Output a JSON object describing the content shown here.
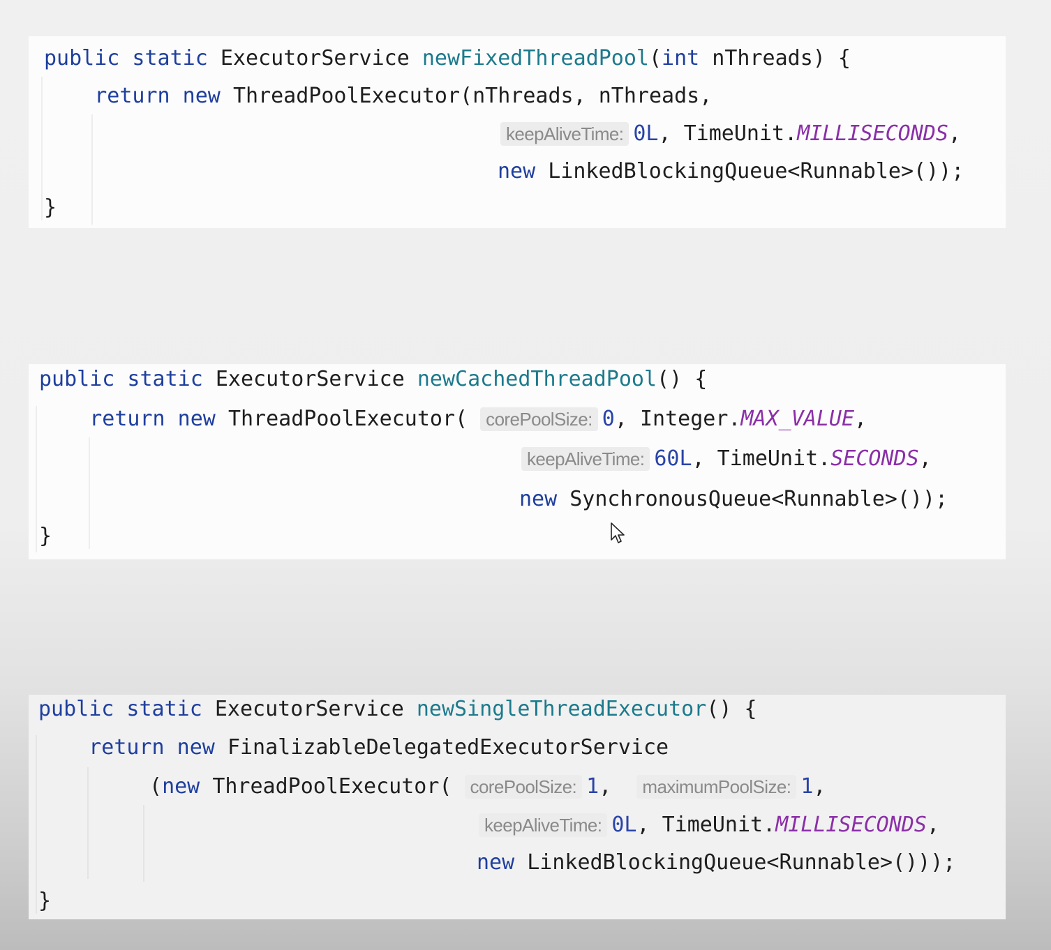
{
  "blocks": [
    {
      "lines": [
        [
          {
            "t": "public static ",
            "c": "kw"
          },
          {
            "t": "ExecutorService ",
            "c": "plain"
          },
          {
            "t": "newFixedThreadPool",
            "c": "fn"
          },
          {
            "t": "(",
            "c": "plain"
          },
          {
            "t": "int",
            "c": "kw"
          },
          {
            "t": " nThreads) {",
            "c": "plain"
          }
        ],
        [
          {
            "t": "    return new ",
            "c": "kw"
          },
          {
            "t": "ThreadPoolExecutor(nThreads, nThreads,",
            "c": "plain"
          }
        ],
        [
          {
            "t": "keepAliveTime:",
            "c": "hint"
          },
          {
            "t": "0L",
            "c": "num"
          },
          {
            "t": ", TimeUnit.",
            "c": "plain"
          },
          {
            "t": "MILLISECONDS",
            "c": "const"
          },
          {
            "t": ",",
            "c": "plain"
          }
        ],
        [
          {
            "t": "new ",
            "c": "kw"
          },
          {
            "t": "LinkedBlockingQueue<Runnable>());",
            "c": "plain"
          }
        ],
        [
          {
            "t": "}",
            "c": "plain"
          }
        ]
      ]
    },
    {
      "lines": [
        [
          {
            "t": "public static ",
            "c": "kw"
          },
          {
            "t": "ExecutorService ",
            "c": "plain"
          },
          {
            "t": "newCachedThreadPool",
            "c": "fn"
          },
          {
            "t": "() {",
            "c": "plain"
          }
        ],
        [
          {
            "t": "    return new ",
            "c": "kw"
          },
          {
            "t": "ThreadPoolExecutor( ",
            "c": "plain"
          },
          {
            "t": "corePoolSize:",
            "c": "hint"
          },
          {
            "t": "0",
            "c": "num"
          },
          {
            "t": ", Integer.",
            "c": "plain"
          },
          {
            "t": "MAX_VALUE",
            "c": "const"
          },
          {
            "t": ",",
            "c": "plain"
          }
        ],
        [
          {
            "t": "keepAliveTime:",
            "c": "hint"
          },
          {
            "t": "60L",
            "c": "num"
          },
          {
            "t": ", TimeUnit.",
            "c": "plain"
          },
          {
            "t": "SECONDS",
            "c": "const"
          },
          {
            "t": ",",
            "c": "plain"
          }
        ],
        [
          {
            "t": "new ",
            "c": "kw"
          },
          {
            "t": "SynchronousQueue<Runnable>());",
            "c": "plain"
          }
        ],
        [
          {
            "t": "}",
            "c": "plain"
          }
        ]
      ]
    },
    {
      "lines": [
        [
          {
            "t": "public static ",
            "c": "kw"
          },
          {
            "t": "ExecutorService ",
            "c": "plain"
          },
          {
            "t": "newSingleThreadExecutor",
            "c": "fn"
          },
          {
            "t": "() {",
            "c": "plain"
          }
        ],
        [
          {
            "t": "    return new ",
            "c": "kw"
          },
          {
            "t": "FinalizableDelegatedExecutorService",
            "c": "plain"
          }
        ],
        [
          {
            "t": "(",
            "c": "plain"
          },
          {
            "t": "new ",
            "c": "kw"
          },
          {
            "t": "ThreadPoolExecutor( ",
            "c": "plain"
          },
          {
            "t": "corePoolSize:",
            "c": "hint"
          },
          {
            "t": "1",
            "c": "num"
          },
          {
            "t": ",  ",
            "c": "plain"
          },
          {
            "t": "maximumPoolSize:",
            "c": "hint"
          },
          {
            "t": "1",
            "c": "num"
          },
          {
            "t": ",",
            "c": "plain"
          }
        ],
        [
          {
            "t": "keepAliveTime:",
            "c": "hint"
          },
          {
            "t": "0L",
            "c": "num"
          },
          {
            "t": ", TimeUnit.",
            "c": "plain"
          },
          {
            "t": "MILLISECONDS",
            "c": "const"
          },
          {
            "t": ",",
            "c": "plain"
          }
        ],
        [
          {
            "t": "new ",
            "c": "kw"
          },
          {
            "t": "LinkedBlockingQueue<Runnable>()));",
            "c": "plain"
          }
        ],
        [
          {
            "t": "}",
            "c": "plain"
          }
        ]
      ]
    }
  ],
  "mouse_cursor": "arrow-cursor-icon"
}
